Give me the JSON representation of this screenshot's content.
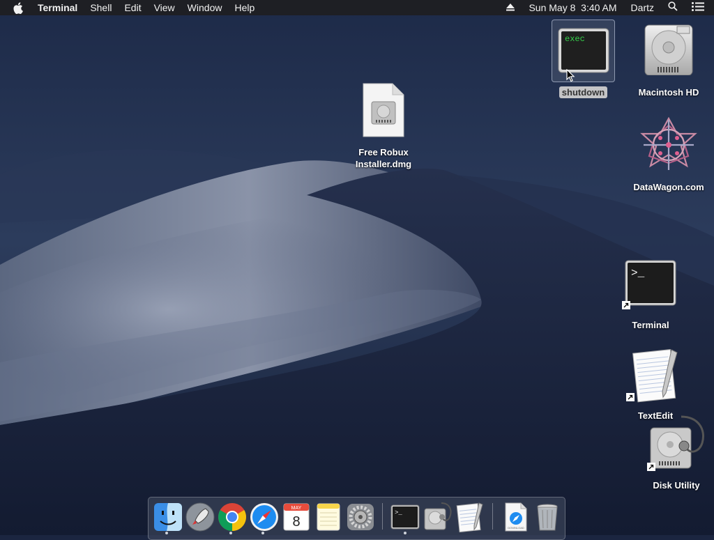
{
  "menubar": {
    "app_name": "Terminal",
    "menus": [
      "Shell",
      "Edit",
      "View",
      "Window",
      "Help"
    ],
    "clock": "Sun May 8  3:40 AM",
    "user": "Dartz"
  },
  "desktop": {
    "selected_item": {
      "thumbnail_text": "exec",
      "label": "shutdown"
    },
    "items": {
      "macintosh_hd": "Macintosh HD",
      "datawagon": "DataWagon.com",
      "free_robux_line1": "Free Robux",
      "free_robux_line2": "Installer.dmg",
      "terminal": "Terminal",
      "textedit": "TextEdit",
      "disk_utility": "Disk Utility"
    },
    "terminal_prompt": ">_"
  },
  "dock": {
    "calendar": {
      "month": "MAY",
      "day": "8"
    },
    "terminal_prompt": ">_",
    "downloads_label": "DOWNLOAD"
  },
  "colors": {
    "menubar_bg": "#1e1e22",
    "exec_text": "#35d04a",
    "selection_label_bg": "#c4c4c6"
  }
}
